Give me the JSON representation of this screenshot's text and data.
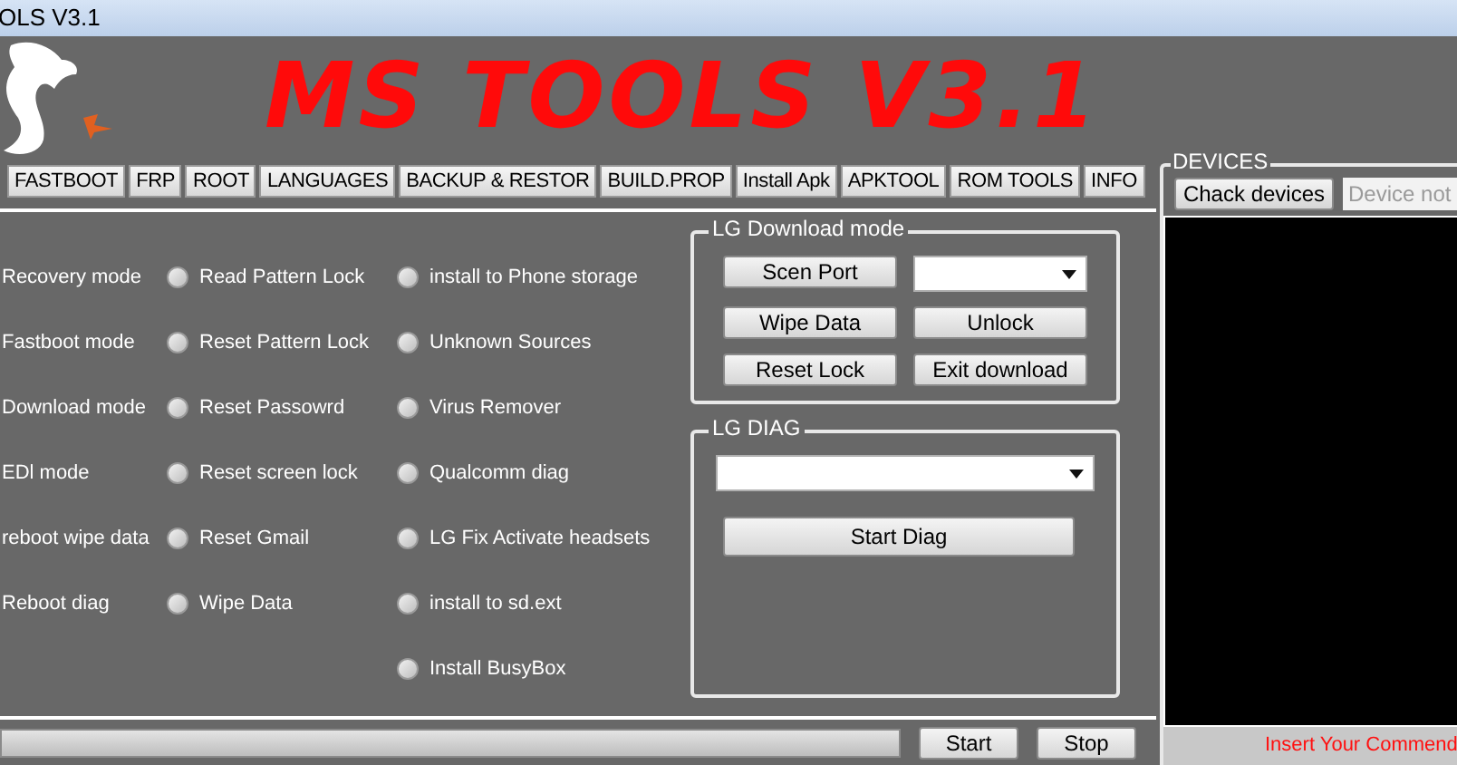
{
  "window": {
    "title": "OLS V3.1"
  },
  "banner": {
    "title": "MS TOOLS V3.1"
  },
  "tabs": [
    {
      "label": "FASTBOOT",
      "selected": false
    },
    {
      "label": "FRP",
      "selected": false
    },
    {
      "label": "ROOT",
      "selected": false
    },
    {
      "label": "LANGUAGES",
      "selected": false
    },
    {
      "label": "BACKUP & RESTOR",
      "selected": false
    },
    {
      "label": "BUILD.PROP",
      "selected": false
    },
    {
      "label": "Install Apk",
      "selected": false
    },
    {
      "label": "APKTOOL",
      "selected": false
    },
    {
      "label": "ROM TOOLS",
      "selected": false
    },
    {
      "label": "INFO",
      "selected": false
    }
  ],
  "modes": [
    "Recovery mode",
    "Fastboot mode",
    "Download mode",
    "EDl mode",
    "reboot wipe data",
    "Reboot diag"
  ],
  "options_left": [
    {
      "label": "Read Pattern Lock",
      "checked": false
    },
    {
      "label": "Reset Pattern Lock",
      "checked": false
    },
    {
      "label": "Reset Passowrd",
      "checked": false
    },
    {
      "label": "Reset screen lock",
      "checked": false
    },
    {
      "label": "Reset Gmail",
      "checked": false
    },
    {
      "label": "Wipe Data",
      "checked": false
    }
  ],
  "options_right": [
    {
      "label": "install to Phone storage",
      "checked": false
    },
    {
      "label": "Unknown Sources",
      "checked": false
    },
    {
      "label": "Virus Remover",
      "checked": false
    },
    {
      "label": "Qualcomm diag",
      "checked": false
    },
    {
      "label": "LG Fix Activate headsets",
      "checked": false
    },
    {
      "label": "install to sd.ext",
      "checked": false
    },
    {
      "label": "Install BusyBox",
      "checked": false
    }
  ],
  "lg_download": {
    "title": "LG Download mode",
    "scan_button": "Scen Port",
    "buttons": [
      "Wipe Data",
      "Unlock",
      "Reset Lock",
      "Exit download"
    ]
  },
  "lg_diag": {
    "title": "LG DIAG",
    "button": "Start Diag"
  },
  "bottom": {
    "progress": {
      "level": 0
    },
    "buttons": [
      "Start",
      "Stop"
    ]
  },
  "devices": {
    "title": "DEVICES",
    "check_button": "Chack devices",
    "device_field": {
      "placeholder": "Device not"
    },
    "command_hint": "Insert Your Commend"
  }
}
